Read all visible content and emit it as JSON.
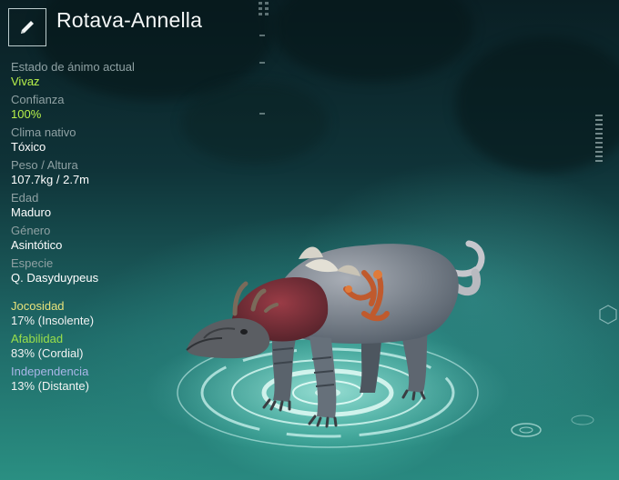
{
  "creature": {
    "name": "Rotava-Annella"
  },
  "icons": {
    "edit": "pencil-icon"
  },
  "stats": [
    {
      "label": "Estado de ánimo actual",
      "value": "Vivaz",
      "accent": true
    },
    {
      "label": "Confianza",
      "value": "100%",
      "accent": true
    },
    {
      "label": "Clima nativo",
      "value": "Tóxico",
      "accent": false
    },
    {
      "label": "Peso / Altura",
      "value": "107.7kg / 2.7m",
      "accent": false
    },
    {
      "label": "Edad",
      "value": "Maduro",
      "accent": false
    },
    {
      "label": "Género",
      "value": "Asintótico",
      "accent": false
    },
    {
      "label": "Especie",
      "value": "Q. Dasyduypeus",
      "accent": false
    }
  ],
  "traits": [
    {
      "label": "Jocosidad",
      "value": "17% (Insolente)",
      "color": "#e8e27a"
    },
    {
      "label": "Afabilidad",
      "value": "83% (Cordial)",
      "color": "#9be04a"
    },
    {
      "label": "Independencia",
      "value": "13% (Distante)",
      "color": "#a9b6e8"
    }
  ],
  "colors": {
    "accent_green": "#b7f04a",
    "label_gray": "#8fa1a3"
  }
}
